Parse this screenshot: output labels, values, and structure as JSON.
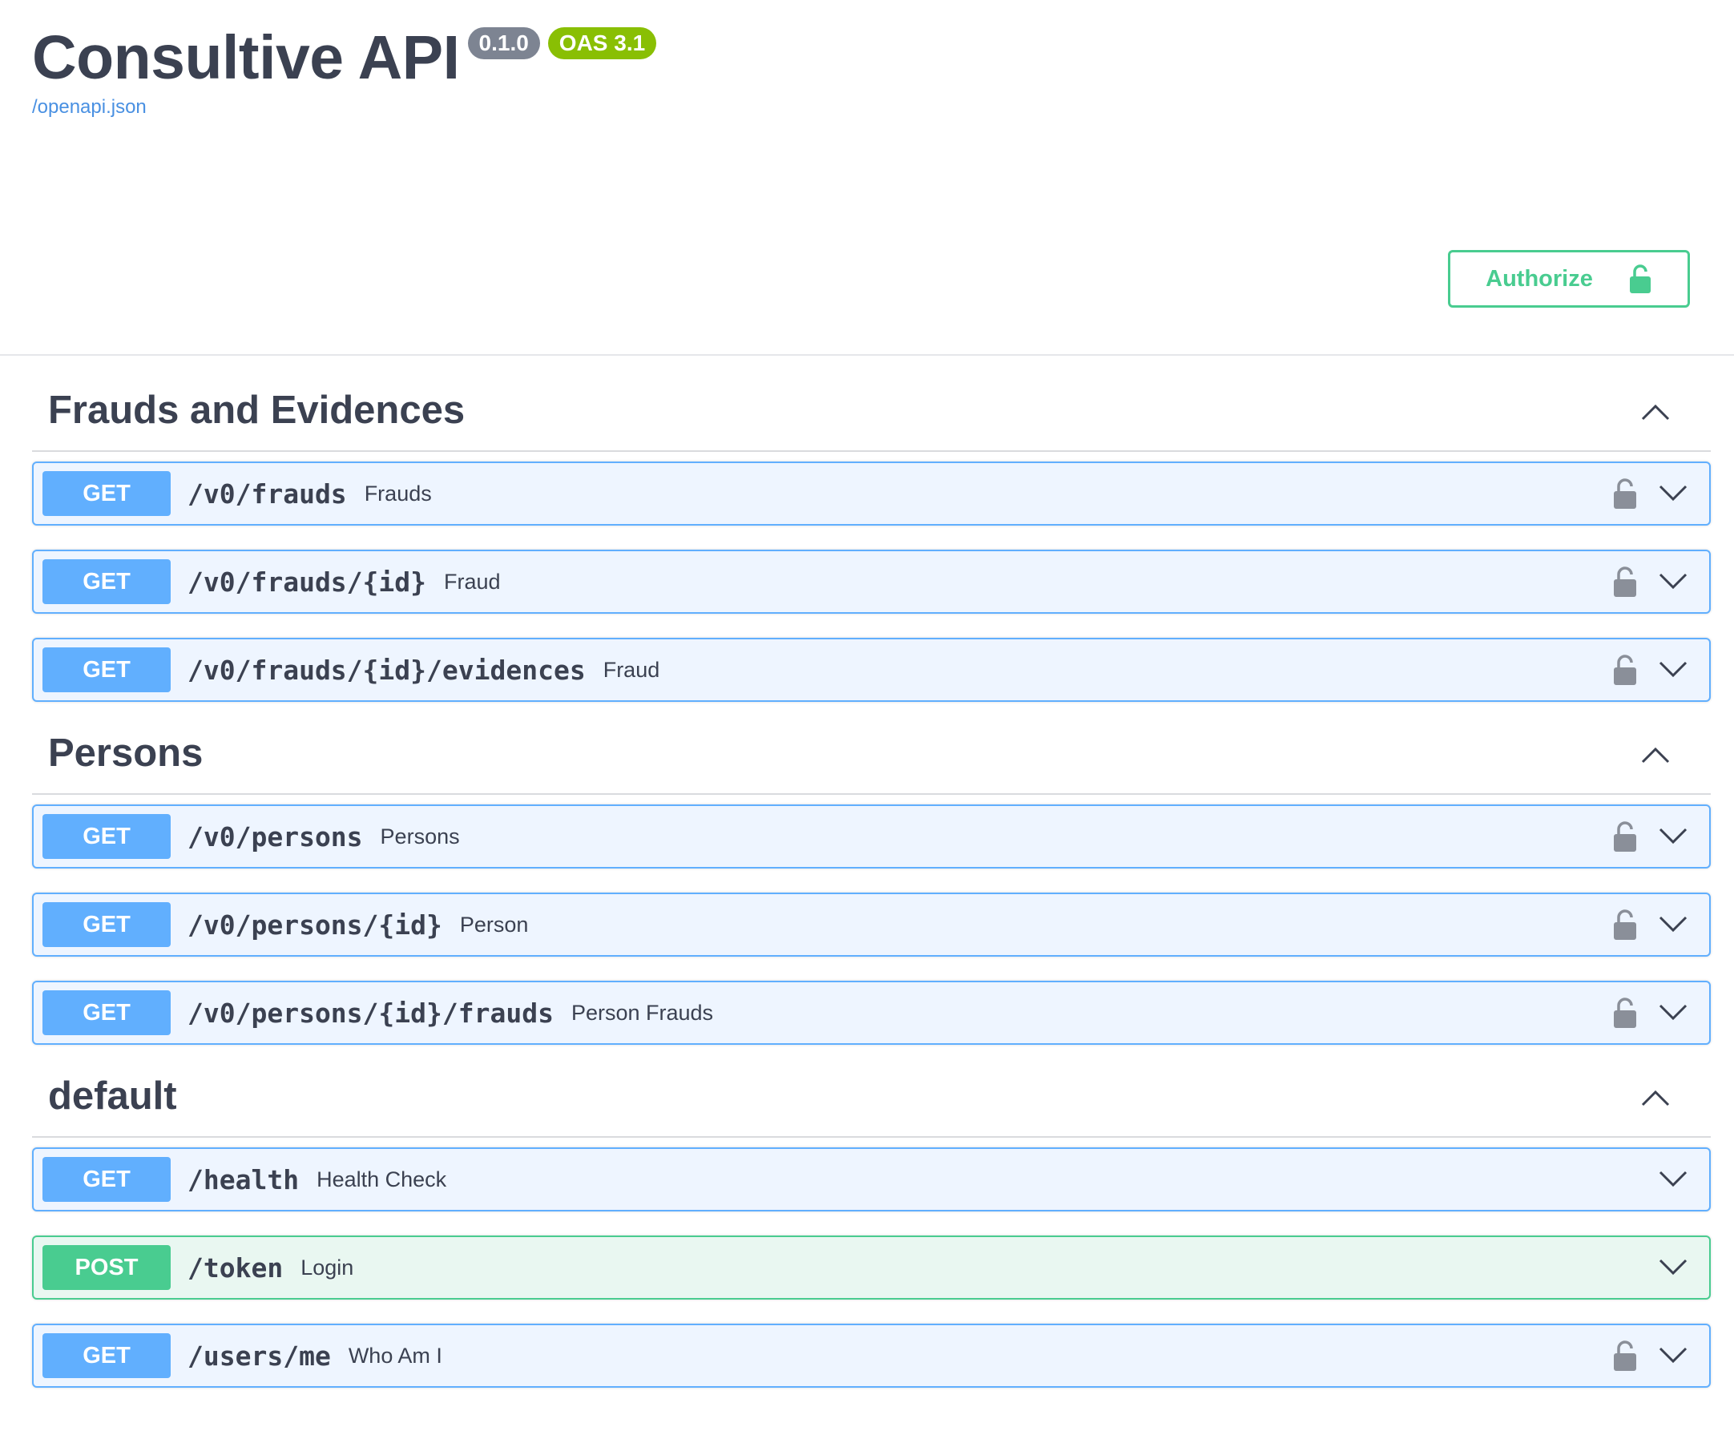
{
  "header": {
    "title": "Consultive API",
    "version": "0.1.0",
    "oas": "OAS 3.1",
    "spec_link": "/openapi.json",
    "authorize_label": "Authorize"
  },
  "colors": {
    "get": "#61affe",
    "post": "#49cc90",
    "authorize": "#49cc90",
    "version_badge": "#7d8492",
    "oas_badge": "#89bf04"
  },
  "sections": [
    {
      "name": "Frauds and Evidences",
      "ops": [
        {
          "method": "GET",
          "path": "/v0/frauds",
          "summary": "Frauds",
          "locked": true
        },
        {
          "method": "GET",
          "path": "/v0/frauds/{id}",
          "summary": "Fraud",
          "locked": true
        },
        {
          "method": "GET",
          "path": "/v0/frauds/{id}/evidences",
          "summary": "Fraud",
          "locked": true
        }
      ]
    },
    {
      "name": "Persons",
      "ops": [
        {
          "method": "GET",
          "path": "/v0/persons",
          "summary": "Persons",
          "locked": true
        },
        {
          "method": "GET",
          "path": "/v0/persons/{id}",
          "summary": "Person",
          "locked": true
        },
        {
          "method": "GET",
          "path": "/v0/persons/{id}/frauds",
          "summary": "Person Frauds",
          "locked": true
        }
      ]
    },
    {
      "name": "default",
      "ops": [
        {
          "method": "GET",
          "path": "/health",
          "summary": "Health Check",
          "locked": false
        },
        {
          "method": "POST",
          "path": "/token",
          "summary": "Login",
          "locked": false
        },
        {
          "method": "GET",
          "path": "/users/me",
          "summary": "Who Am I",
          "locked": true
        }
      ]
    }
  ]
}
